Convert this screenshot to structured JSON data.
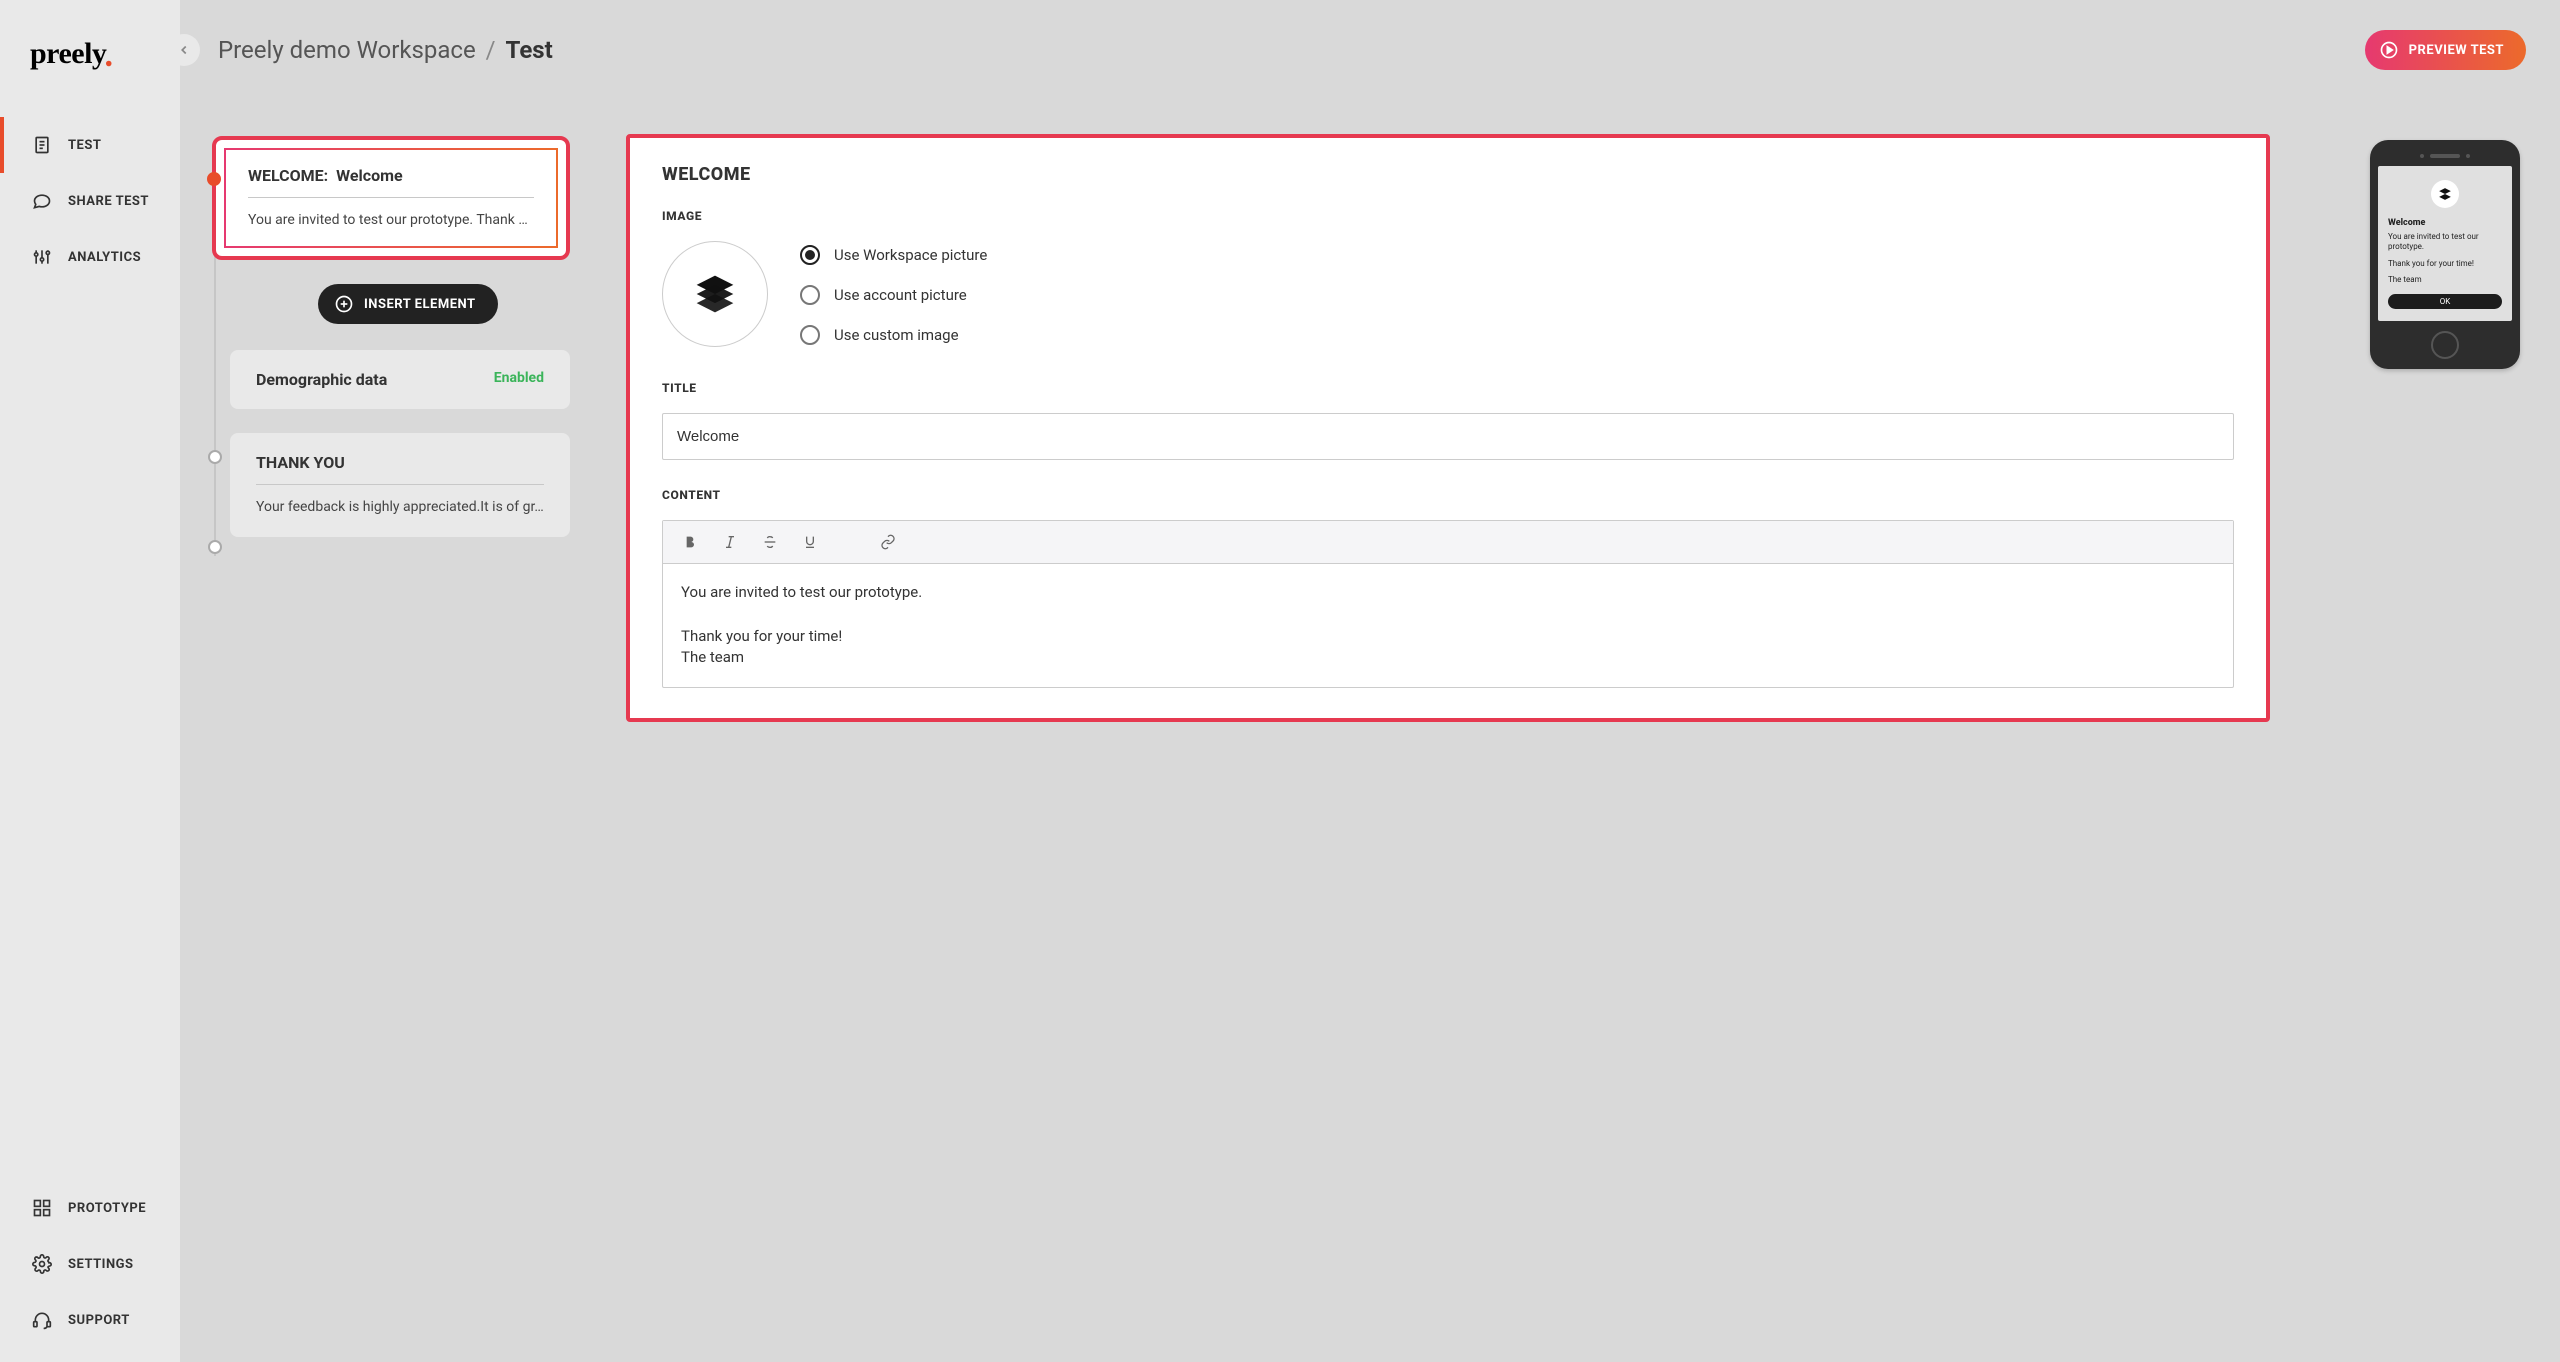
{
  "logo_text": "preely",
  "nav": {
    "top": [
      {
        "label": "TEST",
        "icon": "doc",
        "active": true
      },
      {
        "label": "SHARE TEST",
        "icon": "chat",
        "active": false
      },
      {
        "label": "ANALYTICS",
        "icon": "sliders",
        "active": false
      }
    ],
    "bottom": [
      {
        "label": "PROTOTYPE",
        "icon": "grid"
      },
      {
        "label": "SETTINGS",
        "icon": "gear"
      },
      {
        "label": "SUPPORT",
        "icon": "headset"
      }
    ]
  },
  "breadcrumb": {
    "workspace": "Preely demo Workspace",
    "sep": "/",
    "current": "Test"
  },
  "preview_btn": "PREVIEW TEST",
  "timeline": {
    "welcome": {
      "prefix": "WELCOME:",
      "title": "Welcome",
      "body": "You are invited to test our prototype. Thank yo…"
    },
    "insert_label": "INSERT ELEMENT",
    "demo": {
      "title": "Demographic data",
      "status": "Enabled"
    },
    "thankyou": {
      "title": "THANK YOU",
      "body": "Your feedback is highly appreciated.It is of gr…"
    }
  },
  "editor": {
    "heading": "WELCOME",
    "image_label": "IMAGE",
    "radios": [
      {
        "label": "Use Workspace picture",
        "selected": true
      },
      {
        "label": "Use account picture",
        "selected": false
      },
      {
        "label": "Use custom image",
        "selected": false
      }
    ],
    "title_label": "TITLE",
    "title_value": "Welcome",
    "content_label": "CONTENT",
    "content_text": "You are invited to test our prototype.\n\nThank you for your time!\nThe team"
  },
  "preview_phone": {
    "title": "Welcome",
    "line1": "You are invited to test our prototype.",
    "line2": "Thank you for your time!",
    "line3": "The team",
    "ok": "OK"
  }
}
